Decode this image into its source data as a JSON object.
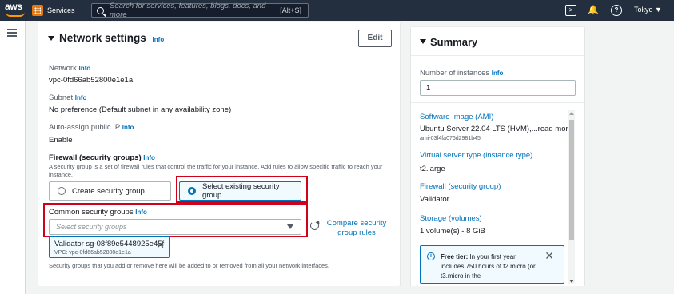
{
  "topbar": {
    "logo": "aws",
    "services_label": "Services",
    "search_placeholder": "Search for services, features, blogs, docs, and more",
    "search_shortcut": "[Alt+S]",
    "cloudshell_icon": "cloudshell-icon",
    "bell_icon": "bell-icon",
    "help_icon": "help-icon",
    "region": "Tokyo ▼"
  },
  "network": {
    "title": "Network settings",
    "title_info": "Info",
    "edit_label": "Edit",
    "network_label": "Network",
    "network_info": "Info",
    "network_value": "vpc-0fd66ab52800e1e1a",
    "subnet_label": "Subnet",
    "subnet_info": "Info",
    "subnet_value": "No preference (Default subnet in any availability zone)",
    "public_ip_label": "Auto-assign public IP",
    "public_ip_info": "Info",
    "public_ip_value": "Enable",
    "firewall_label": "Firewall (security groups)",
    "firewall_info": "Info",
    "firewall_desc": "A security group is a set of firewall rules that control the traffic for your instance. Add rules to allow specific traffic to reach your instance.",
    "option_create": "Create security group",
    "option_existing": "Select existing security group",
    "common_sg_label": "Common security groups",
    "common_sg_info": "Info",
    "select_placeholder": "Select security groups",
    "compare_link": "Compare security group rules",
    "token_name": "Validator  sg-08f89e5448925e45f",
    "token_vpc": "VPC: vpc-0fd66ab52800e1e1a",
    "sg_footer": "Security groups that you add or remove here will be added to or removed from all your network interfaces."
  },
  "summary": {
    "title": "Summary",
    "instances_label": "Number of instances",
    "instances_info": "Info",
    "instances_value": "1",
    "ami_link": "Software Image (AMI)",
    "ami_value": "Ubuntu Server 22.04 LTS (HVM),...read more",
    "ami_id": "ami-03f4fa076d2981b45",
    "type_link": "Virtual server type (instance type)",
    "type_value": "t2.large",
    "firewall_link": "Firewall (security group)",
    "firewall_value": "Validator",
    "storage_link": "Storage (volumes)",
    "storage_value": "1 volume(s) - 8 GiB",
    "free_tier_bold": "Free tier:",
    "free_tier_text": " In your first year includes 750 hours of t2.micro (or t3.micro in the"
  }
}
